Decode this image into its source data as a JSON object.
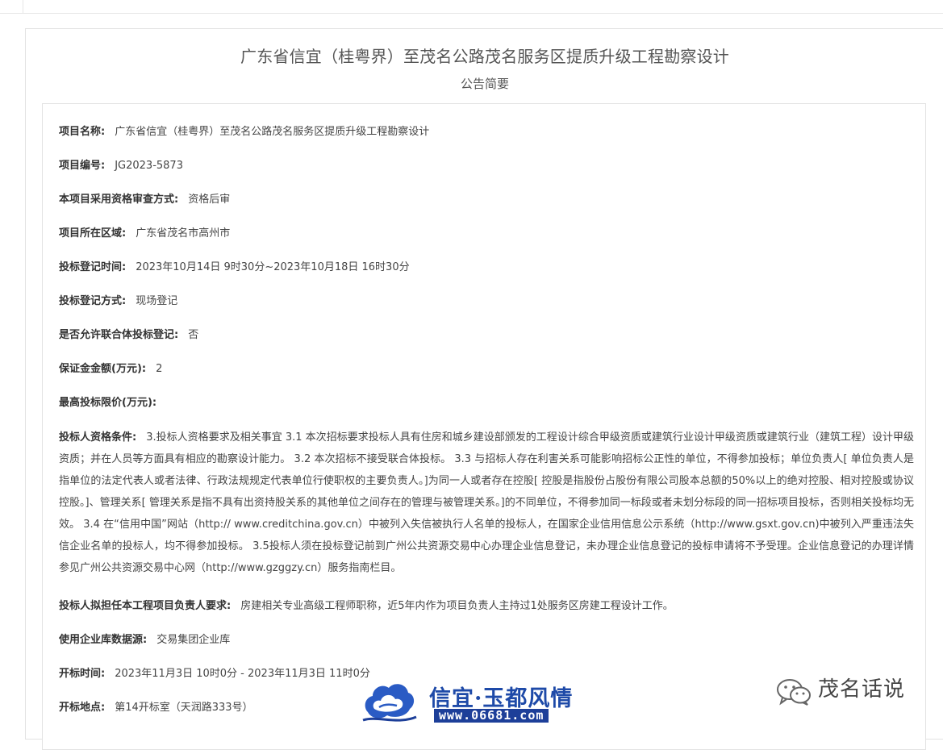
{
  "announcement": {
    "title": "广东省信宜（桂粤界）至茂名公路茂名服务区提质升级工程勘察设计",
    "subtitle": "公告简要"
  },
  "fields": [
    {
      "label": "项目名称:",
      "value": "广东省信宜（桂粤界）至茂名公路茂名服务区提质升级工程勘察设计"
    },
    {
      "label": "项目编号:",
      "value": "JG2023-5873"
    },
    {
      "label": "本项目采用资格审查方式:",
      "value": "资格后审"
    },
    {
      "label": "项目所在区域:",
      "value": "广东省茂名市高州市"
    },
    {
      "label": "投标登记时间:",
      "value": "2023年10月14日 9时30分~2023年10月18日 16时30分"
    },
    {
      "label": "投标登记方式:",
      "value": "现场登记"
    },
    {
      "label": "是否允许联合体投标登记:",
      "value": "否"
    },
    {
      "label": "保证金金额(万元):",
      "value": "2"
    },
    {
      "label": "最高投标限价(万元):",
      "value": ""
    },
    {
      "label": "投标人资格条件:",
      "value": "3.投标人资格要求及相关事宜 3.1 本次招标要求投标人具有住房和城乡建设部颁发的工程设计综合甲级资质或建筑行业设计甲级资质或建筑行业（建筑工程）设计甲级资质；并在人员等方面具有相应的勘察设计能力。 3.2 本次招标不接受联合体投标。 3.3 与招标人存在利害关系可能影响招标公正性的单位，不得参加投标；单位负责人[ 单位负责人是指单位的法定代表人或者法律、行政法规规定代表单位行使职权的主要负责人。]为同一人或者存在控股[ 控股是指股份占股份有限公司股本总额的50%以上的绝对控股、相对控股或协议控股。]、管理关系[ 管理关系是指不具有出资持股关系的其他单位之间存在的管理与被管理关系。]的不同单位，不得参加同一标段或者未划分标段的同一招标项目投标，否则相关投标均无效。 3.4 在“信用中国”网站（http:// www.creditchina.gov.cn）中被列入失信被执行人名单的投标人，在国家企业信用信息公示系统（http://www.gsxt.gov.cn)中被列入严重违法失信企业名单的投标人，均不得参加投标。 3.5投标人须在投标登记前到广州公共资源交易中心办理企业信息登记，未办理企业信息登记的投标申请将不予受理。企业信息登记的办理详情参见广州公共资源交易中心网（http://www.gzggzy.cn）服务指南栏目。"
    },
    {
      "label": "投标人拟担任本工程项目负责人要求:",
      "value": "房建相关专业高级工程师职称，近5年内作为项目负责人主持过1处服务区房建工程设计工作。"
    },
    {
      "label": "使用企业库数据源:",
      "value": "交易集团企业库"
    },
    {
      "label": "开标时间:",
      "value": "2023年11月3日 10时0分 - 2023年11月3日 11时0分"
    },
    {
      "label": "开标地点:",
      "value": "第14开标室（天润路333号）"
    }
  ],
  "watermark": {
    "title": "信宜·玉都风情",
    "url": "www.06681.com"
  },
  "wechat": {
    "icon": "wechat-icon",
    "account_name": "茂名话说"
  }
}
